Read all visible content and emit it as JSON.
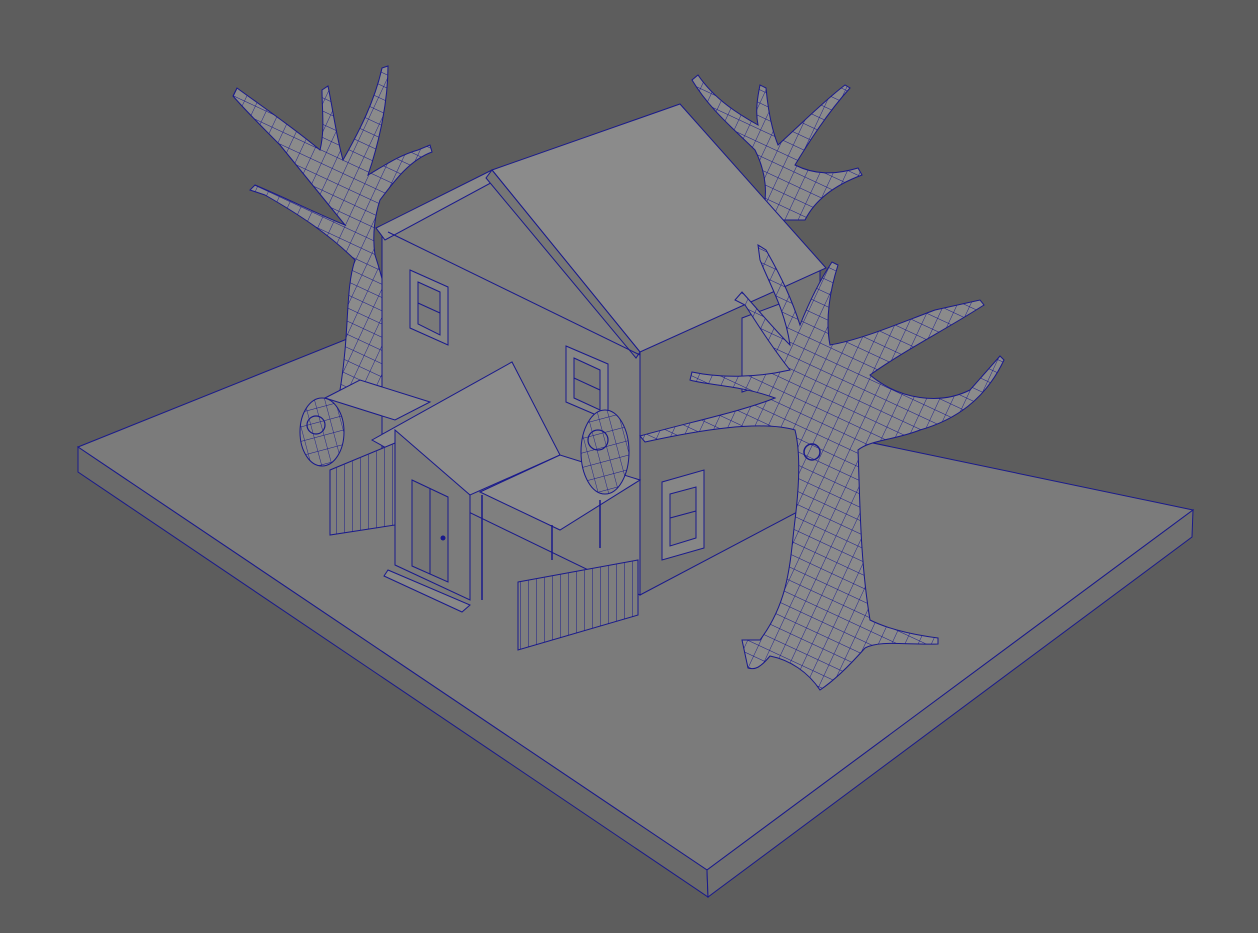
{
  "viewport": {
    "background": "#5d5d5d",
    "wire_color": "#1a1a8c",
    "surface_light": "#8a8a8a",
    "surface_mid": "#7b7b7b",
    "surface_dark": "#6a6a6a",
    "surface_side": "#707070"
  }
}
